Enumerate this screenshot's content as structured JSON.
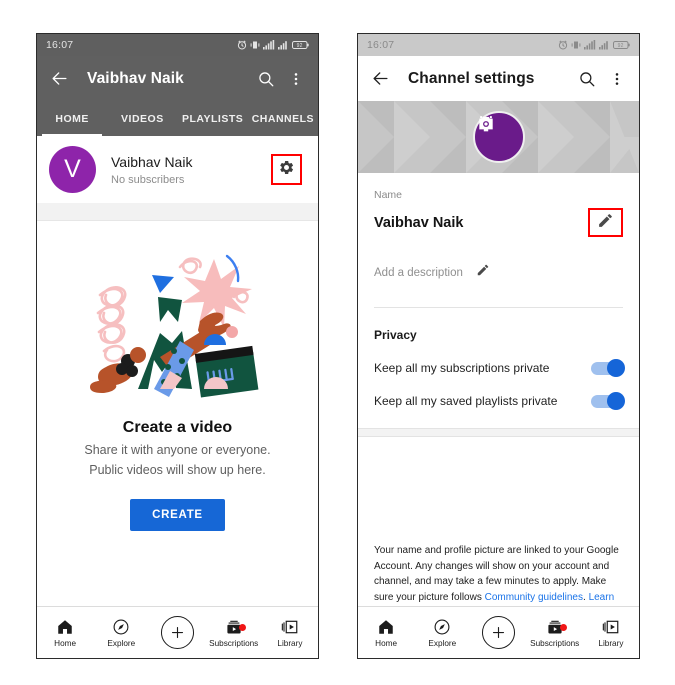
{
  "left_phone": {
    "status_bar": {
      "time": "16:07",
      "icons": [
        "alarm-icon",
        "vibrate-icon",
        "signal-1-icon",
        "signal-2-icon",
        "battery-icon"
      ]
    },
    "app_bar": {
      "back_icon": "back-arrow-icon",
      "title": "Vaibhav Naik",
      "search_icon": "search-icon",
      "overflow_icon": "more-vertical-icon"
    },
    "tabs": [
      {
        "label": "HOME",
        "active": true
      },
      {
        "label": "VIDEOS",
        "active": false
      },
      {
        "label": "PLAYLISTS",
        "active": false
      },
      {
        "label": "CHANNELS",
        "active": false
      }
    ],
    "channel_row": {
      "avatar_initial": "V",
      "avatar_color": "#8e24aa",
      "name": "Vaibhav Naik",
      "subscribers": "No subscribers",
      "settings_icon": "gear-icon",
      "highlight_color": "#ff0000"
    },
    "empty_state": {
      "illustration": "create-video-illustration",
      "title": "Create a video",
      "line1": "Share it with anyone or everyone.",
      "line2": "Public videos will show up here.",
      "button_label": "CREATE",
      "button_color": "#1667d6"
    },
    "bottom_nav": [
      {
        "label": "Home",
        "icon": "home-icon",
        "badge": false
      },
      {
        "label": "Explore",
        "icon": "compass-icon",
        "badge": false
      },
      {
        "label": "",
        "icon": "plus-circle-icon",
        "badge": false
      },
      {
        "label": "Subscriptions",
        "icon": "subscriptions-icon",
        "badge": true
      },
      {
        "label": "Library",
        "icon": "library-icon",
        "badge": false
      }
    ]
  },
  "right_phone": {
    "status_bar": {
      "time": "16:07",
      "icons": [
        "alarm-icon",
        "vibrate-icon",
        "signal-1-icon",
        "signal-2-icon",
        "battery-icon"
      ]
    },
    "app_bar": {
      "back_icon": "back-arrow-icon",
      "title": "Channel settings",
      "search_icon": "search-icon",
      "overflow_icon": "more-vertical-icon"
    },
    "banner": {
      "avatar_icon": "camera-icon",
      "avatar_color": "#6a1b8a"
    },
    "name_field": {
      "label": "Name",
      "value": "Vaibhav Naik",
      "edit_icon": "pencil-icon",
      "highlight_color": "#ff0000"
    },
    "description_field": {
      "placeholder": "Add a description",
      "edit_icon": "pencil-icon"
    },
    "privacy": {
      "title": "Privacy",
      "toggles": [
        {
          "label": "Keep all my subscriptions private",
          "on": true
        },
        {
          "label": "Keep all my saved playlists private",
          "on": true
        }
      ],
      "toggle_on_color": "#1565d8"
    },
    "footnote": {
      "text": "Your name and profile picture are linked to your Google Account. Any changes will show on your account and channel, and may take a few minutes to apply. Make sure your picture follows ",
      "link1": "Community guidelines",
      "between": ". ",
      "link2": "Learn more",
      "link_color": "#1a73e8"
    },
    "bottom_nav": [
      {
        "label": "Home",
        "icon": "home-icon",
        "badge": false
      },
      {
        "label": "Explore",
        "icon": "compass-icon",
        "badge": false
      },
      {
        "label": "",
        "icon": "plus-circle-icon",
        "badge": false
      },
      {
        "label": "Subscriptions",
        "icon": "subscriptions-icon",
        "badge": true
      },
      {
        "label": "Library",
        "icon": "library-icon",
        "badge": false
      }
    ]
  }
}
